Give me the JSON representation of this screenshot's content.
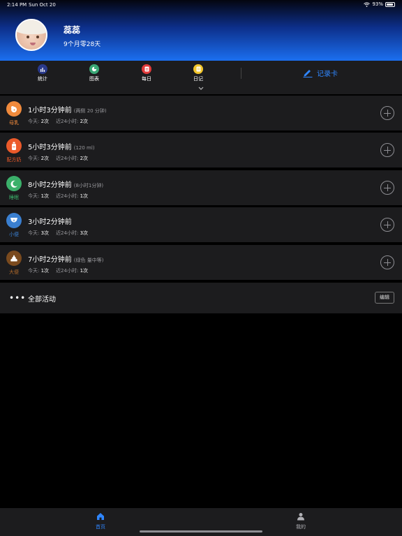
{
  "status_bar": {
    "time": "2:14 PM",
    "date": "Sun Oct 20",
    "battery_text": "93%",
    "battery_level": 0.93
  },
  "profile": {
    "name": "蕊蕊",
    "age": "9个月零28天"
  },
  "toolbar": {
    "items": [
      {
        "label": "统计",
        "icon": "stats-icon",
        "color": "#2a3a8c"
      },
      {
        "label": "图表",
        "icon": "chart-icon",
        "color": "#3aa876"
      },
      {
        "label": "每日",
        "icon": "daily-icon",
        "color": "#e23b3b"
      },
      {
        "label": "日记",
        "icon": "diary-icon",
        "color": "#f2c52a"
      }
    ],
    "record_card_label": "记录卡",
    "accent": "#2f86ff"
  },
  "activities": [
    {
      "type_label": "母乳",
      "icon": "breastfeeding-icon",
      "color": "#f08a3c",
      "label_color": "#f08a3c",
      "title": "1小时3分钟前",
      "detail": "(两侧 20 分钟)",
      "today_label": "今天:",
      "today_value": "2次",
      "last24_label": "近24小时:",
      "last24_value": "2次"
    },
    {
      "type_label": "配方奶",
      "icon": "bottle-icon",
      "color": "#ec5a2a",
      "label_color": "#ec5a2a",
      "title": "5小时3分钟前",
      "detail": "(120 ml)",
      "today_label": "今天:",
      "today_value": "2次",
      "last24_label": "近24小时:",
      "last24_value": "2次"
    },
    {
      "type_label": "睡眠",
      "icon": "moon-icon",
      "color": "#3bb06a",
      "label_color": "#3bb06a",
      "title": "8小时2分钟前",
      "detail": "(8小时1分钟)",
      "today_label": "今天:",
      "today_value": "1次",
      "last24_label": "近24小时:",
      "last24_value": "1次"
    },
    {
      "type_label": "小便",
      "icon": "diaper-wet-icon",
      "color": "#3a7fd0",
      "label_color": "#3a7fd0",
      "title": "3小时2分钟前",
      "detail": "",
      "today_label": "今天:",
      "today_value": "3次",
      "last24_label": "近24小时:",
      "last24_value": "3次"
    },
    {
      "type_label": "大便",
      "icon": "poop-icon",
      "color": "#7a4a1e",
      "label_color": "#b06a2a",
      "title": "7小时2分钟前",
      "detail": "(绿色 量中等)",
      "today_label": "今天:",
      "today_value": "1次",
      "last24_label": "近24小时:",
      "last24_value": "1次"
    }
  ],
  "all_activities": {
    "label": "全部活动",
    "edit_label": "编辑"
  },
  "tabbar": {
    "home_label": "首页",
    "mine_label": "我的",
    "active_color": "#2f86ff",
    "inactive_color": "#b0b0b5"
  }
}
